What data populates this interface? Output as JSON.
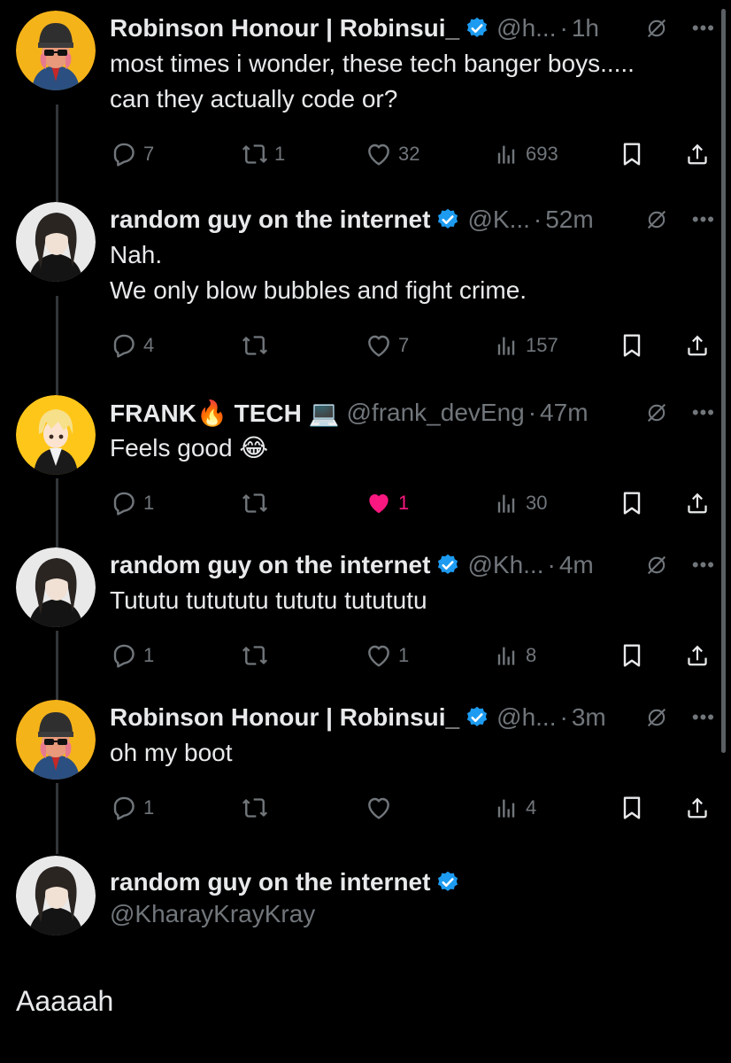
{
  "tweets": [
    {
      "name": "Robinson Honour | Robinsui_",
      "verified": true,
      "handle": "@h...",
      "time": "1h",
      "lines": [
        "most times i wonder, these tech banger boys.....",
        "can they actually code or?"
      ],
      "reply_count": "7",
      "retweet_count": "1",
      "like_count": "32",
      "view_count": "693",
      "liked": false,
      "avatar": "robinson-avatar"
    },
    {
      "name": "random guy on the internet",
      "verified": true,
      "handle": "@K...",
      "time": "52m",
      "lines": [
        "Nah.",
        "We only blow bubbles and fight crime."
      ],
      "reply_count": "4",
      "retweet_count": "",
      "like_count": "7",
      "view_count": "157",
      "liked": false,
      "avatar": "random-guy-avatar"
    },
    {
      "name": "FRANK🔥 TECH 💻",
      "verified": false,
      "handle": "@frank_devEng",
      "time": "47m",
      "lines": [
        "Feels good 😂"
      ],
      "reply_count": "1",
      "retweet_count": "",
      "like_count": "1",
      "view_count": "30",
      "liked": true,
      "avatar": "frank-avatar"
    },
    {
      "name": "random guy on the internet",
      "verified": true,
      "handle": "@Kh...",
      "time": "4m",
      "lines": [
        "Tututu tutututu tututu tutututu"
      ],
      "reply_count": "1",
      "retweet_count": "",
      "like_count": "1",
      "view_count": "8",
      "liked": false,
      "avatar": "random-guy-avatar"
    },
    {
      "name": "Robinson Honour | Robinsui_",
      "verified": true,
      "handle": "@h...",
      "time": "3m",
      "lines": [
        "oh my boot"
      ],
      "reply_count": "1",
      "retweet_count": "",
      "like_count": "",
      "view_count": "4",
      "liked": false,
      "avatar": "robinson-avatar"
    }
  ],
  "main_tweet": {
    "name": "random guy on the internet",
    "verified": true,
    "handle": "@KharayKrayKray",
    "text": "Aaaaah"
  },
  "colors": {
    "background": "#000000",
    "text": "#e7e9ea",
    "muted": "#71767b",
    "verified": "#1d9bf0",
    "like": "#f91880"
  }
}
